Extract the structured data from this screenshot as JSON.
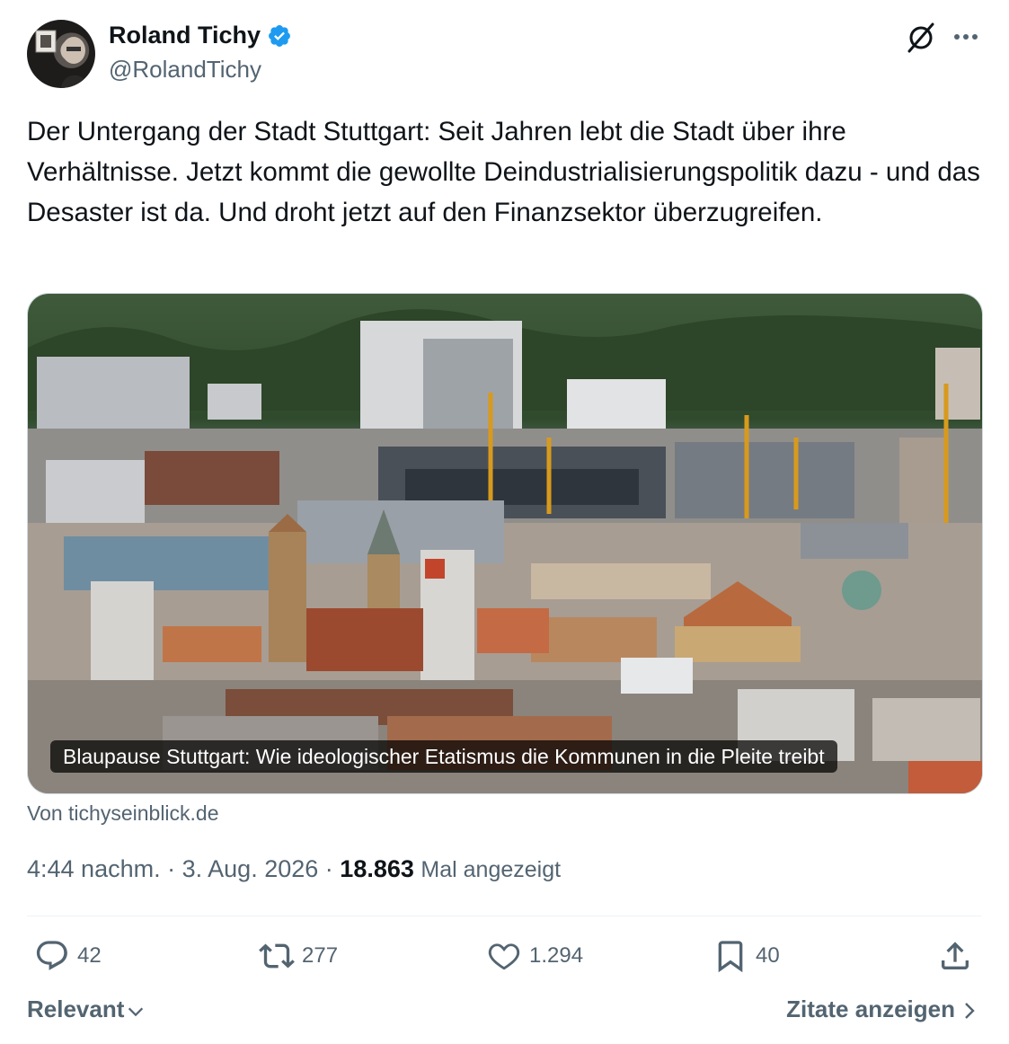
{
  "author": {
    "name": "Roland Tichy",
    "handle": "@RolandTichy",
    "verified": true,
    "verified_color": "#1d9bf0"
  },
  "tweet": {
    "text": "Der Untergang der Stadt Stuttgart: Seit Jahren lebt die Stadt über ihre Verhältnisse. Jetzt kommt die gewollte Deindustrialisierungspolitik dazu - und das Desaster ist da. Und droht jetzt auf den Finanzsektor überzugreifen."
  },
  "card": {
    "title": "Blaupause Stuttgart: Wie ideologischer Etatismus die Kommunen in die Pleite treibt",
    "source": "Von tichyseinblick.de",
    "image": "aerial-city-view-stuttgart"
  },
  "meta": {
    "time": "4:44 nachm.",
    "separator": "·",
    "date": "3. Aug. 2026",
    "views_count": "18.863",
    "views_label": "Mal angezeigt"
  },
  "actions": {
    "reply": "42",
    "retweet": "277",
    "like": "1.294",
    "bookmark": "40"
  },
  "footer": {
    "sort_label": "Relevant",
    "quotes_label": "Zitate anzeigen"
  },
  "icons": [
    "grok-icon",
    "more-icon",
    "verified-icon",
    "reply-icon",
    "retweet-icon",
    "like-icon",
    "bookmark-icon",
    "share-icon",
    "chevron-down-icon",
    "chevron-right-icon"
  ],
  "colors": {
    "text": "#0f1419",
    "secondary": "#536471",
    "accent": "#1d9bf0"
  }
}
